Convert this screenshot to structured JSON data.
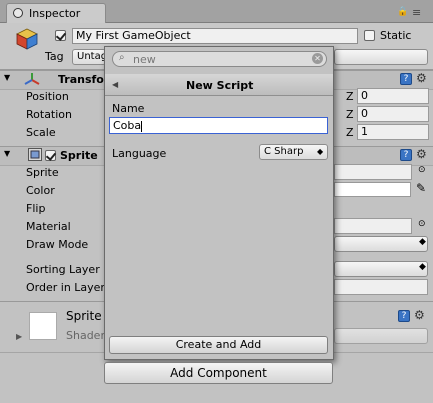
{
  "tab": {
    "title": "Inspector"
  },
  "gameobject": {
    "name": "My First GameObject",
    "static_label": "Static",
    "tag_label": "Tag",
    "tag_value": "Untag"
  },
  "transform": {
    "title": "Transfo",
    "rows": [
      {
        "label": "Position",
        "z_label": "Z",
        "z_value": "0"
      },
      {
        "label": "Rotation",
        "z_label": "Z",
        "z_value": "0"
      },
      {
        "label": "Scale",
        "z_label": "Z",
        "z_value": "1"
      }
    ]
  },
  "sprite_renderer": {
    "title": "Sprite",
    "labels": {
      "sprite": "Sprite",
      "color": "Color",
      "flip": "Flip",
      "material": "Material",
      "draw_mode": "Draw Mode",
      "sorting_layer": "Sorting Layer",
      "order_in_layer": "Order in Layer"
    }
  },
  "material_section": {
    "name": "Sprite",
    "shader_label": "Shader"
  },
  "popup": {
    "search_placeholder": "new",
    "title": "New Script",
    "name_label": "Name",
    "name_value": "Coba",
    "language_label": "Language",
    "language_value": "C Sharp",
    "create_button": "Create and Add"
  },
  "add_component_button": "Add Component",
  "icons": {
    "gameobject": "cube-icon",
    "transform": "axes-icon",
    "sprite": "sprite-renderer-icon",
    "help": "help-book-icon",
    "settings": "gear-icon",
    "search": "search-icon",
    "clear": "clear-icon",
    "back": "back-arrow-icon",
    "eyedropper": "eyedropper-icon"
  }
}
